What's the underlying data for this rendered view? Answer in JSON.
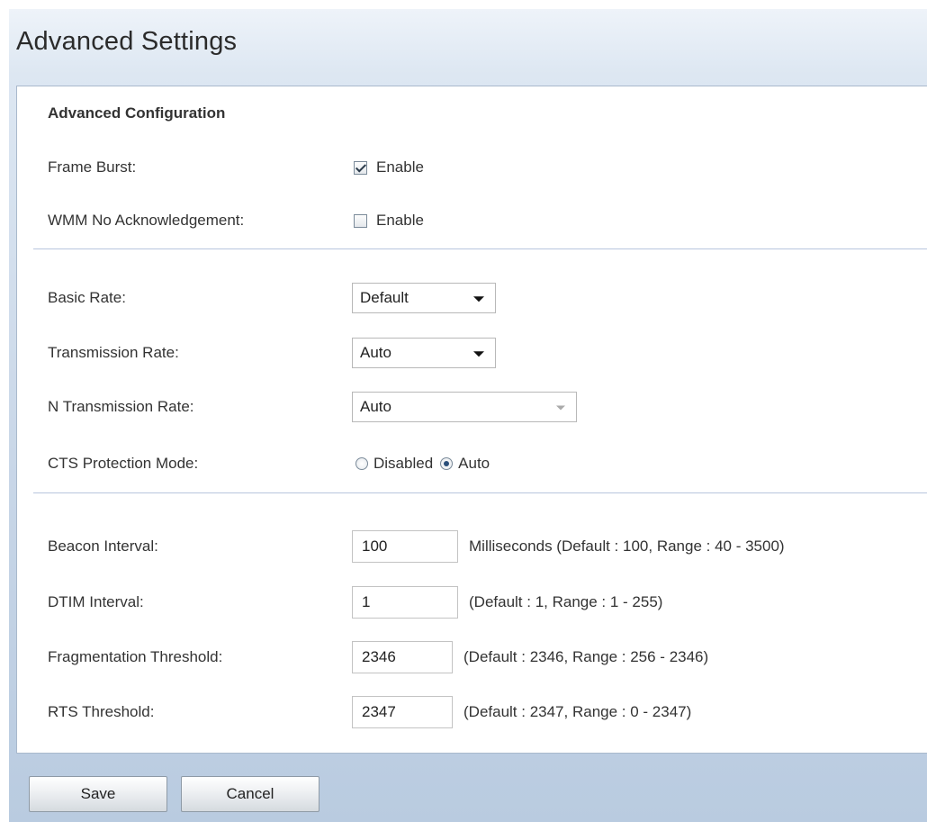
{
  "page": {
    "title": "Advanced Settings"
  },
  "section": {
    "heading": "Advanced Configuration"
  },
  "frame_burst": {
    "label": "Frame Burst:",
    "option": "Enable",
    "checked": true
  },
  "wmm_no_ack": {
    "label": "WMM No Acknowledgement:",
    "option": "Enable",
    "checked": false
  },
  "basic_rate": {
    "label": "Basic Rate:",
    "value": "Default"
  },
  "transmission_rate": {
    "label": "Transmission Rate:",
    "value": "Auto"
  },
  "n_transmission_rate": {
    "label": "N Transmission Rate:",
    "value": "Auto"
  },
  "cts_protection": {
    "label": "CTS Protection Mode:",
    "options": [
      "Disabled",
      "Auto"
    ],
    "selected": "Auto"
  },
  "beacon_interval": {
    "label": "Beacon Interval:",
    "value": "100",
    "hint": "Milliseconds (Default : 100, Range : 40 - 3500)"
  },
  "dtim_interval": {
    "label": "DTIM Interval:",
    "value": "1",
    "hint": "(Default : 1, Range : 1 - 255)"
  },
  "fragmentation_threshold": {
    "label": "Fragmentation Threshold:",
    "value": "2346",
    "hint": "(Default : 2346, Range : 256 - 2346)"
  },
  "rts_threshold": {
    "label": "RTS Threshold:",
    "value": "2347",
    "hint": "(Default : 2347, Range : 0 - 2347)"
  },
  "buttons": {
    "save": "Save",
    "cancel": "Cancel"
  },
  "colors": {
    "background_top": "#eef3f9",
    "background_bottom": "#b9cbe0",
    "divider": "#b8c5de",
    "panel_border": "#a9b9cc"
  }
}
